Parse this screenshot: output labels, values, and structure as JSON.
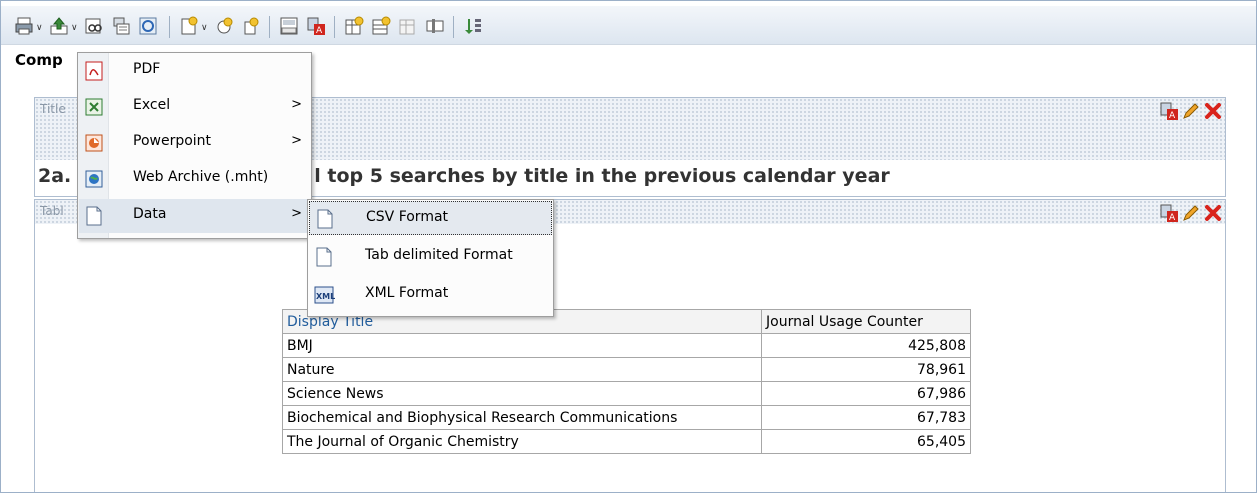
{
  "page": {
    "section_label": "Comp"
  },
  "toolbar": {
    "icons": [
      "print-icon",
      "export-icon",
      "view-icon",
      "copy-icon",
      "refresh-icon",
      "new-view-icon",
      "add-icon",
      "settings-icon",
      "xyz-icon",
      "pdf-edit-icon",
      "insert-icon",
      "insert2-icon",
      "disabled-icon",
      "column-icon",
      "sort-icon"
    ]
  },
  "menu": {
    "items": [
      {
        "label": "PDF",
        "icon": "pdf-icon",
        "has_submenu": false
      },
      {
        "label": "Excel",
        "icon": "excel-icon",
        "has_submenu": true
      },
      {
        "label": "Powerpoint",
        "icon": "powerpoint-icon",
        "has_submenu": true
      },
      {
        "label": "Web Archive (.mht)",
        "icon": "web-archive-icon",
        "has_submenu": false
      },
      {
        "label": "Data",
        "icon": "data-icon",
        "has_submenu": true
      }
    ],
    "submenu_arrow": ">"
  },
  "submenu": {
    "items": [
      {
        "label": "CSV Format",
        "icon": "csv-file-icon"
      },
      {
        "label": "Tab delimited Format",
        "icon": "tab-file-icon"
      },
      {
        "label": "XML Format",
        "icon": "xml-icon"
      }
    ]
  },
  "panels": {
    "title_panel": {
      "label": "Title",
      "text_prefix": "2a.",
      "text_main": "l top 5 searches by title in the previous calendar year"
    },
    "table_panel": {
      "label": "Tabl"
    }
  },
  "table": {
    "headers": [
      "Display Title",
      "Journal Usage Counter"
    ],
    "rows": [
      [
        "BMJ",
        "425,808"
      ],
      [
        "Nature",
        "78,961"
      ],
      [
        "Science News",
        "67,986"
      ],
      [
        "Biochemical and Biophysical Research Communications",
        "67,783"
      ],
      [
        "The Journal of Organic Chemistry",
        "65,405"
      ]
    ]
  },
  "colors": {
    "header_link": "#225d9c",
    "delete_red": "#d9231c",
    "toolbar_bg": "#dde6f0"
  }
}
